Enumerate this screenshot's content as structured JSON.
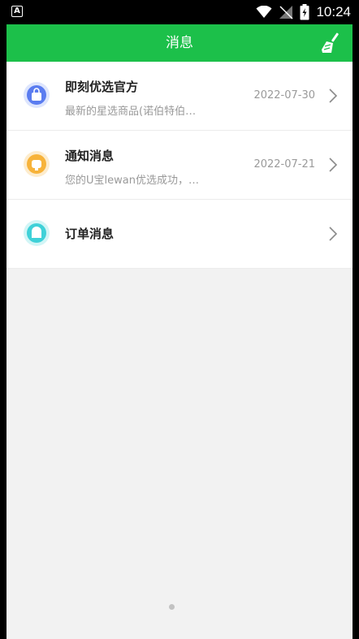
{
  "status_bar": {
    "notification_icon": "A",
    "time": "10:24",
    "icons": [
      "wifi-icon",
      "signal-icon",
      "battery-charging-icon"
    ]
  },
  "header": {
    "title": "消息",
    "action_icon": "broom-icon"
  },
  "messages": [
    {
      "title": "即刻优选官方",
      "subtitle": "最新的星选商品(诺伯特伯…",
      "date": "2022-07-30",
      "icon": "shopping-bag-icon",
      "icon_color": "#5a7cf0"
    },
    {
      "title": "通知消息",
      "subtitle": "您的U宝lewan优选成功，…",
      "date": "2022-07-21",
      "icon": "notification-icon",
      "icon_color": "#f7b33a"
    },
    {
      "title": "订单消息",
      "subtitle": "",
      "date": "",
      "icon": "order-icon",
      "icon_color": "#3fd1d8"
    }
  ],
  "colors": {
    "accent": "#1cc04a",
    "background": "#f2f2f2"
  }
}
